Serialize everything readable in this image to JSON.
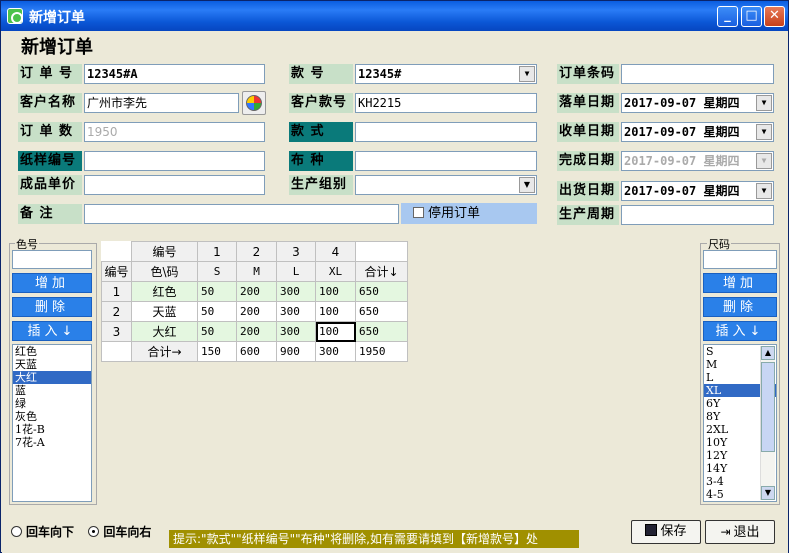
{
  "window": {
    "title": "新增订单",
    "heading": "新增订单"
  },
  "fields": {
    "order_no": {
      "label": "订 单 号",
      "value": "12345#A"
    },
    "style_no": {
      "label": "款    号",
      "value": "12345#"
    },
    "order_barcode": {
      "label": "订单条码",
      "value": ""
    },
    "customer_name": {
      "label": "客户名称",
      "value": "广州市李先"
    },
    "customer_style_no": {
      "label": "客户款号",
      "value": "KH2215"
    },
    "order_date": {
      "label": "落单日期",
      "value": "2017-09-07 星期四"
    },
    "order_qty": {
      "label": "订 单 数",
      "value": "1950"
    },
    "style": {
      "label": "款    式",
      "value": ""
    },
    "receive_date": {
      "label": "收单日期",
      "value": "2017-09-07 星期四"
    },
    "pattern_no": {
      "label": "纸样编号",
      "value": ""
    },
    "fabric": {
      "label": "布    种",
      "value": ""
    },
    "finish_date": {
      "label": "完成日期",
      "value": "2017-09-07 星期四"
    },
    "unit_price": {
      "label": "成品单价",
      "value": ""
    },
    "production_group": {
      "label": "生产组别",
      "value": ""
    },
    "ship_date": {
      "label": "出货日期",
      "value": "2017-09-07 星期四"
    },
    "remark": {
      "label": "备    注",
      "value": ""
    },
    "disable_order": {
      "label": "停用订单"
    },
    "production_cycle": {
      "label": "生产周期",
      "value": ""
    }
  },
  "color_panel": {
    "title": "色号",
    "input": "",
    "add": "增加",
    "delete": "删除",
    "insert": "插入↓",
    "items": [
      "红色",
      "天蓝",
      "大红",
      "蓝",
      "绿",
      "灰色",
      "1花-B",
      "7花-A"
    ],
    "selected_index": 2
  },
  "size_panel": {
    "title": "尺码",
    "input": "",
    "add": "增加",
    "delete": "删除",
    "insert": "插入↓",
    "items": [
      "S",
      "M",
      "L",
      "XL",
      "6Y",
      "8Y",
      "2XL",
      "10Y",
      "12Y",
      "14Y",
      "3-4",
      "4-5"
    ],
    "selected_index": 3
  },
  "grid": {
    "hdr1": [
      "编号",
      "1",
      "2",
      "3",
      "4"
    ],
    "hdr2": [
      "编号",
      "色\\码",
      "S",
      "M",
      "L",
      "XL",
      "合计↓"
    ],
    "rows": [
      {
        "no": "1",
        "color": "红色",
        "vals": [
          "50",
          "200",
          "300",
          "100",
          "650"
        ]
      },
      {
        "no": "2",
        "color": "天蓝",
        "vals": [
          "50",
          "200",
          "300",
          "100",
          "650"
        ]
      },
      {
        "no": "3",
        "color": "大红",
        "vals": [
          "50",
          "200",
          "300",
          "100",
          "650"
        ]
      }
    ],
    "total_label": "合计→",
    "totals": [
      "150",
      "600",
      "900",
      "300",
      "1950"
    ]
  },
  "footer": {
    "enter_down": "回车向下",
    "enter_right": "回车向右",
    "hint": "提示:\"款式\"\"纸样编号\"\"布种\"将删除,如有需要请填到【新增款号】处",
    "save": "保存",
    "exit": "退出"
  }
}
